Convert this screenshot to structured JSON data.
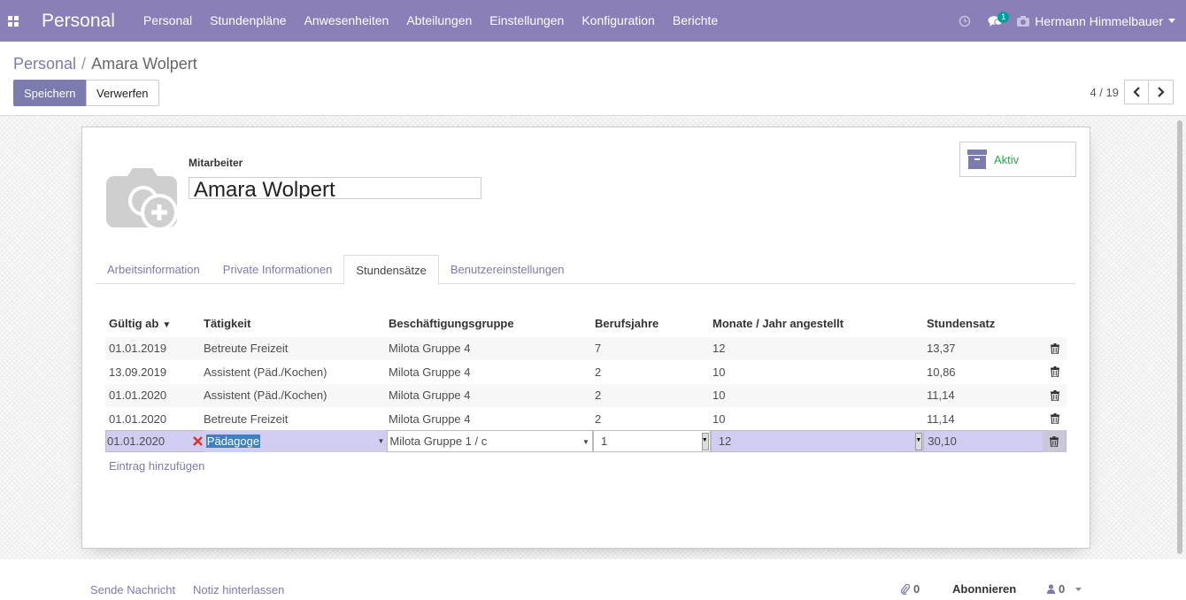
{
  "navbar": {
    "brand": "Personal",
    "menu": [
      "Personal",
      "Stundenpläne",
      "Anwesenheiten",
      "Abteilungen",
      "Einstellungen",
      "Konfiguration",
      "Berichte"
    ],
    "messages_badge": "1",
    "user_name": "Hermann Himmelbauer"
  },
  "breadcrumb": {
    "parent": "Personal",
    "separator": "/",
    "current": "Amara Wolpert"
  },
  "buttons": {
    "save": "Speichern",
    "discard": "Verwerfen"
  },
  "pager": {
    "value": "4 / 19"
  },
  "employee": {
    "label": "Mitarbeiter",
    "name": "Amara Wolpert",
    "status": "Aktiv"
  },
  "tabs": [
    "Arbeitsinformation",
    "Private Informationen",
    "Stundensätze",
    "Benutzereinstellungen"
  ],
  "active_tab": "Stundensätze",
  "table": {
    "headers": [
      "Gültig ab",
      "Tätigkeit",
      "Beschäftigungsgruppe",
      "Berufsjahre",
      "Monate / Jahr angestellt",
      "Stundensatz"
    ],
    "rows": [
      [
        "01.01.2019",
        "Betreute Freizeit",
        "Milota Gruppe 4",
        "7",
        "12",
        "13,37"
      ],
      [
        "13.09.2019",
        "Assistent (Päd./Kochen)",
        "Milota Gruppe 4",
        "2",
        "10",
        "10,86"
      ],
      [
        "01.01.2020",
        "Assistent (Päd./Kochen)",
        "Milota Gruppe 4",
        "2",
        "10",
        "11,14"
      ],
      [
        "01.01.2020",
        "Betreute Freizeit",
        "Milota Gruppe 4",
        "2",
        "10",
        "11,14"
      ]
    ],
    "edit_row": {
      "date": "01.01.2020",
      "job": "Pädagoge",
      "group": "Milota Gruppe 1 / c",
      "years": "1",
      "months": "12",
      "rate": "30,10"
    },
    "add_line": "Eintrag hinzufügen"
  },
  "chatter": {
    "send_message": "Sende Nachricht",
    "log_note": "Notiz hinterlassen",
    "attachments_count": "0",
    "follow": "Abonnieren",
    "followers_count": "0"
  },
  "colors": {
    "navbar": "#8b7fb8",
    "primary": "#7c7bad",
    "active_status": "#28a745",
    "edit_row": "#d0cdf1"
  }
}
